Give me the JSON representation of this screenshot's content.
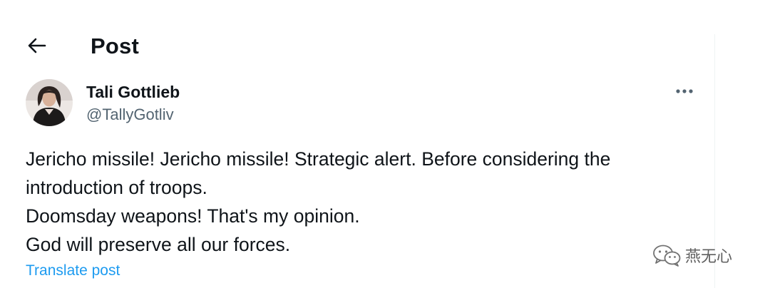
{
  "header": {
    "title": "Post",
    "back_icon": "arrow-left-icon"
  },
  "post": {
    "author": {
      "name": "Tali Gottlieb",
      "handle": "@TallyGotliv",
      "avatar_icon": "avatar-photo"
    },
    "more_icon": "more-dots-icon",
    "text_lines": [
      "Jericho missile! Jericho missile! Strategic alert. Before considering the",
      "introduction of troops.",
      "Doomsday weapons! That's my opinion.",
      "God will preserve all our forces."
    ],
    "translate_label": "Translate post"
  },
  "watermark": {
    "text": "燕无心",
    "icon": "wechat-logo-icon"
  },
  "colors": {
    "text_primary": "#0f1419",
    "text_secondary": "#536471",
    "link": "#1d9bf0",
    "divider": "#eff3f4"
  }
}
